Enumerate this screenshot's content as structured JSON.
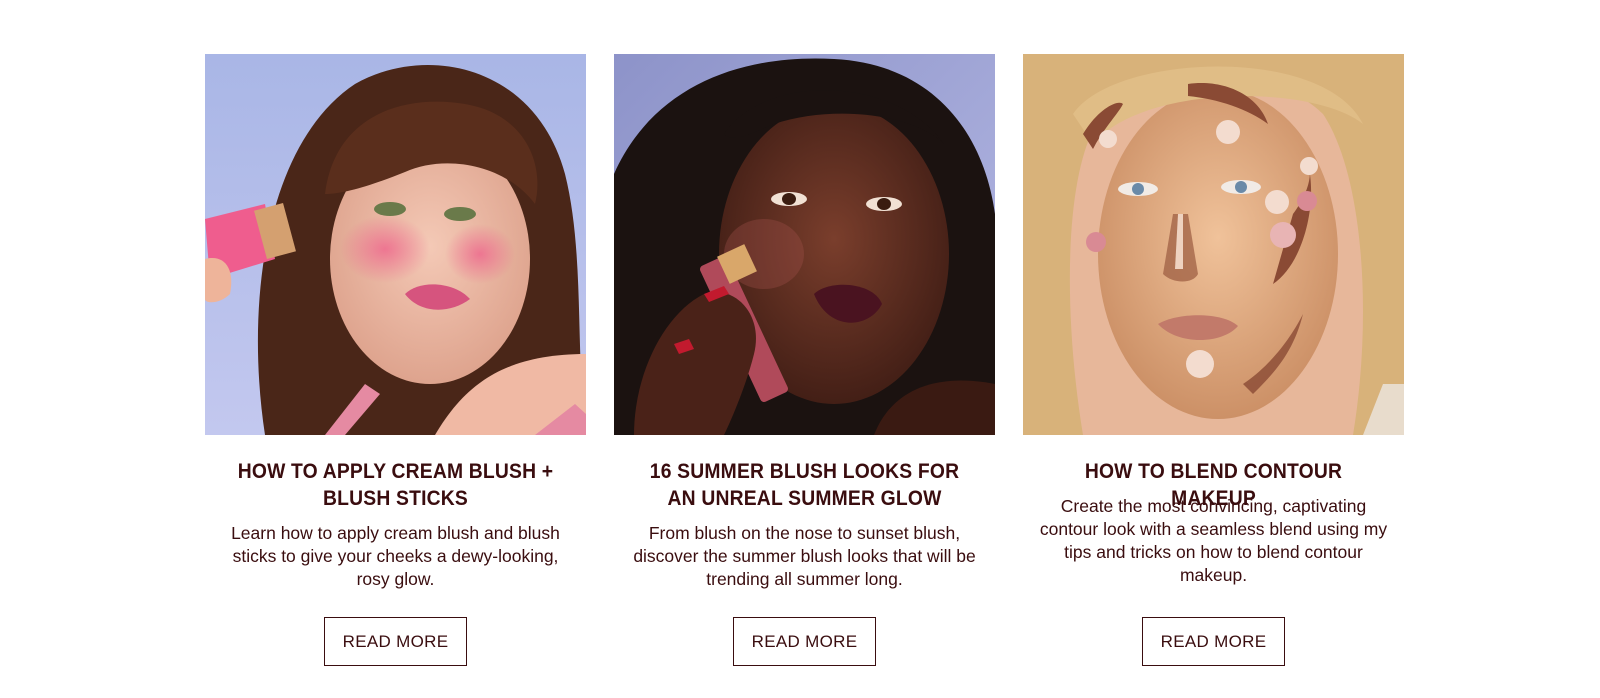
{
  "cards": [
    {
      "image_alt": "Woman with bangs applying a pink blush stick to her cheek",
      "title": "HOW TO APPLY CREAM BLUSH + BLUSH STICKS",
      "description": "Learn how to apply cream blush and blush sticks to give your cheeks a dewy-looking, rosy glow.",
      "button_label": "READ MORE"
    },
    {
      "image_alt": "Woman holding a blush stick against her cheek with a glossy plum lip",
      "title": "16 SUMMER BLUSH LOOKS FOR AN UNREAL SUMMER GLOW",
      "description": "From blush on the nose to sunset blush, discover the summer blush looks that will be trending all summer long.",
      "button_label": "READ MORE"
    },
    {
      "image_alt": "Blonde woman with contour, highlight and blush swatches mapped on her face",
      "title": "HOW TO BLEND CONTOUR MAKEUP",
      "description": "Create the most convincing, captivating contour look with a seamless blend using my tips and tricks on how to blend contour makeup.",
      "button_label": "READ MORE"
    }
  ],
  "colors": {
    "text": "#3a0d0f",
    "background": "#ffffff",
    "button_border": "#3a0d0f"
  }
}
